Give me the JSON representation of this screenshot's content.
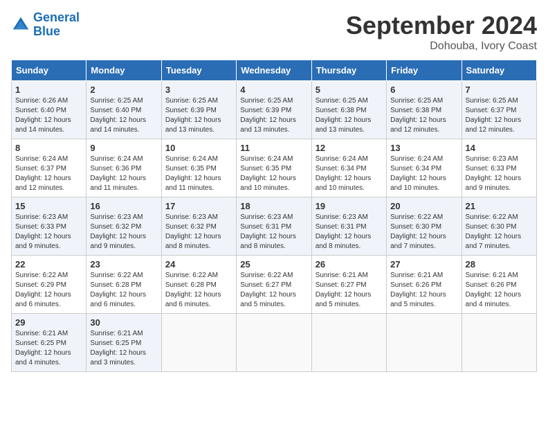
{
  "header": {
    "logo_line1": "General",
    "logo_line2": "Blue",
    "month": "September 2024",
    "location": "Dohouba, Ivory Coast"
  },
  "weekdays": [
    "Sunday",
    "Monday",
    "Tuesday",
    "Wednesday",
    "Thursday",
    "Friday",
    "Saturday"
  ],
  "weeks": [
    [
      {
        "day": "1",
        "sr": "6:26 AM",
        "ss": "6:40 PM",
        "dl": "12 hours and 14 minutes."
      },
      {
        "day": "2",
        "sr": "6:25 AM",
        "ss": "6:40 PM",
        "dl": "12 hours and 14 minutes."
      },
      {
        "day": "3",
        "sr": "6:25 AM",
        "ss": "6:39 PM",
        "dl": "12 hours and 13 minutes."
      },
      {
        "day": "4",
        "sr": "6:25 AM",
        "ss": "6:39 PM",
        "dl": "12 hours and 13 minutes."
      },
      {
        "day": "5",
        "sr": "6:25 AM",
        "ss": "6:38 PM",
        "dl": "12 hours and 13 minutes."
      },
      {
        "day": "6",
        "sr": "6:25 AM",
        "ss": "6:38 PM",
        "dl": "12 hours and 12 minutes."
      },
      {
        "day": "7",
        "sr": "6:25 AM",
        "ss": "6:37 PM",
        "dl": "12 hours and 12 minutes."
      }
    ],
    [
      {
        "day": "8",
        "sr": "6:24 AM",
        "ss": "6:37 PM",
        "dl": "12 hours and 12 minutes."
      },
      {
        "day": "9",
        "sr": "6:24 AM",
        "ss": "6:36 PM",
        "dl": "12 hours and 11 minutes."
      },
      {
        "day": "10",
        "sr": "6:24 AM",
        "ss": "6:35 PM",
        "dl": "12 hours and 11 minutes."
      },
      {
        "day": "11",
        "sr": "6:24 AM",
        "ss": "6:35 PM",
        "dl": "12 hours and 10 minutes."
      },
      {
        "day": "12",
        "sr": "6:24 AM",
        "ss": "6:34 PM",
        "dl": "12 hours and 10 minutes."
      },
      {
        "day": "13",
        "sr": "6:24 AM",
        "ss": "6:34 PM",
        "dl": "12 hours and 10 minutes."
      },
      {
        "day": "14",
        "sr": "6:23 AM",
        "ss": "6:33 PM",
        "dl": "12 hours and 9 minutes."
      }
    ],
    [
      {
        "day": "15",
        "sr": "6:23 AM",
        "ss": "6:33 PM",
        "dl": "12 hours and 9 minutes."
      },
      {
        "day": "16",
        "sr": "6:23 AM",
        "ss": "6:32 PM",
        "dl": "12 hours and 9 minutes."
      },
      {
        "day": "17",
        "sr": "6:23 AM",
        "ss": "6:32 PM",
        "dl": "12 hours and 8 minutes."
      },
      {
        "day": "18",
        "sr": "6:23 AM",
        "ss": "6:31 PM",
        "dl": "12 hours and 8 minutes."
      },
      {
        "day": "19",
        "sr": "6:23 AM",
        "ss": "6:31 PM",
        "dl": "12 hours and 8 minutes."
      },
      {
        "day": "20",
        "sr": "6:22 AM",
        "ss": "6:30 PM",
        "dl": "12 hours and 7 minutes."
      },
      {
        "day": "21",
        "sr": "6:22 AM",
        "ss": "6:30 PM",
        "dl": "12 hours and 7 minutes."
      }
    ],
    [
      {
        "day": "22",
        "sr": "6:22 AM",
        "ss": "6:29 PM",
        "dl": "12 hours and 6 minutes."
      },
      {
        "day": "23",
        "sr": "6:22 AM",
        "ss": "6:28 PM",
        "dl": "12 hours and 6 minutes."
      },
      {
        "day": "24",
        "sr": "6:22 AM",
        "ss": "6:28 PM",
        "dl": "12 hours and 6 minutes."
      },
      {
        "day": "25",
        "sr": "6:22 AM",
        "ss": "6:27 PM",
        "dl": "12 hours and 5 minutes."
      },
      {
        "day": "26",
        "sr": "6:21 AM",
        "ss": "6:27 PM",
        "dl": "12 hours and 5 minutes."
      },
      {
        "day": "27",
        "sr": "6:21 AM",
        "ss": "6:26 PM",
        "dl": "12 hours and 5 minutes."
      },
      {
        "day": "28",
        "sr": "6:21 AM",
        "ss": "6:26 PM",
        "dl": "12 hours and 4 minutes."
      }
    ],
    [
      {
        "day": "29",
        "sr": "6:21 AM",
        "ss": "6:25 PM",
        "dl": "12 hours and 4 minutes."
      },
      {
        "day": "30",
        "sr": "6:21 AM",
        "ss": "6:25 PM",
        "dl": "12 hours and 3 minutes."
      },
      null,
      null,
      null,
      null,
      null
    ]
  ],
  "labels": {
    "sunrise": "Sunrise:",
    "sunset": "Sunset:",
    "daylight": "Daylight:"
  }
}
